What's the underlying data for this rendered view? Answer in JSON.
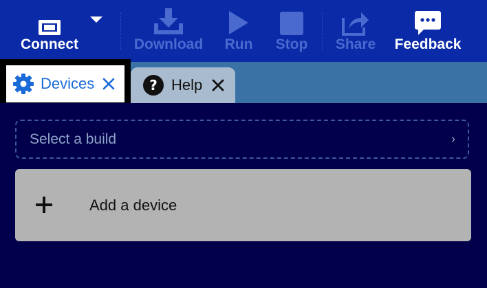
{
  "toolbar": {
    "connect_label": "Connect",
    "download_label": "Download",
    "run_label": "Run",
    "stop_label": "Stop",
    "share_label": "Share",
    "feedback_label": "Feedback"
  },
  "tabs": [
    {
      "label": "Devices",
      "icon": "gear-icon",
      "active": true
    },
    {
      "label": "Help",
      "icon": "help-circle-icon",
      "active": false
    }
  ],
  "build_select": {
    "placeholder": "Select a build",
    "chevron": "›"
  },
  "add_device": {
    "label": "Add a device",
    "icon": "plus-icon"
  },
  "colors": {
    "toolbar_bg": "#0a2aa8",
    "tabbar_bg": "#3a72a6",
    "panel_bg": "#02004a",
    "accent": "#1a6ad8",
    "disabled": "#4a6ad0",
    "card_bg": "#b3b3b3"
  }
}
